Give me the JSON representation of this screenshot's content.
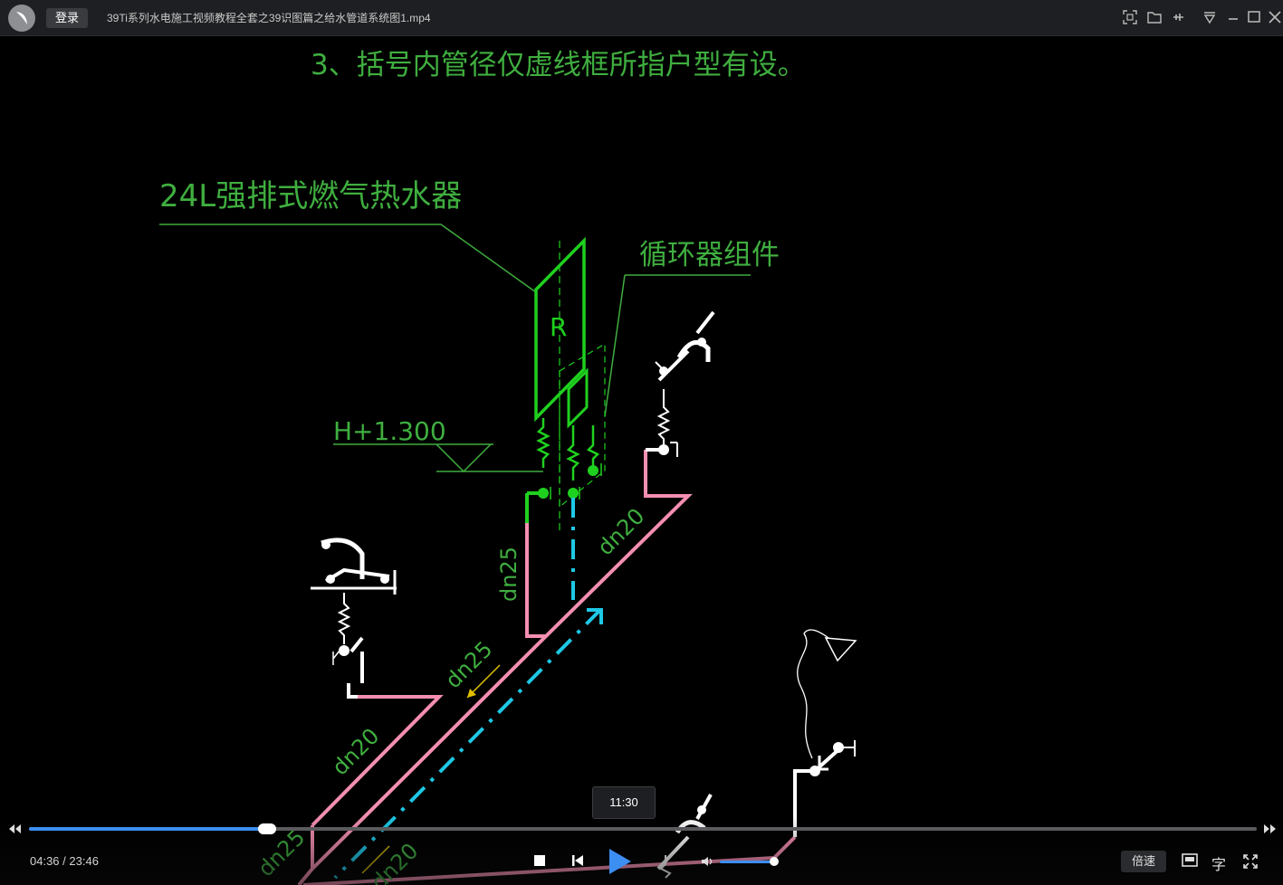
{
  "titlebar": {
    "login_label": "登录",
    "file_title": "39Ti系列水电施工视频教程全套之39识图篇之给水管道系统图1.mp4"
  },
  "cad": {
    "note": "3、括号内管径仅虚线框所指户型有设。",
    "heater_label": "24L强排式燃气热水器",
    "circulator_label": "循环器组件",
    "elevation": "H+1.300",
    "heater_letter": "R",
    "pipe_dn25_a": "dn25",
    "pipe_dn20_a": "dn20",
    "pipe_dn25_b": "dn25",
    "pipe_dn20_b": "dn20",
    "pipe_dn25_c": "dn25",
    "pipe_dn20_c": "dn20",
    "colors": {
      "green": "#1fd11f",
      "pink": "#f48fb1",
      "cyan": "#1ec8e6",
      "white": "#ffffff",
      "label_green": "#3fae3f"
    }
  },
  "player": {
    "tooltip_time": "11:30",
    "current_time": "04:36",
    "total_time": "23:46",
    "time_separator": " / ",
    "progress_fraction": 0.194,
    "volume_fraction": 1.0,
    "speed_label": "倍速",
    "subtitle_label": "字",
    "accent": "#3d8ef1"
  }
}
